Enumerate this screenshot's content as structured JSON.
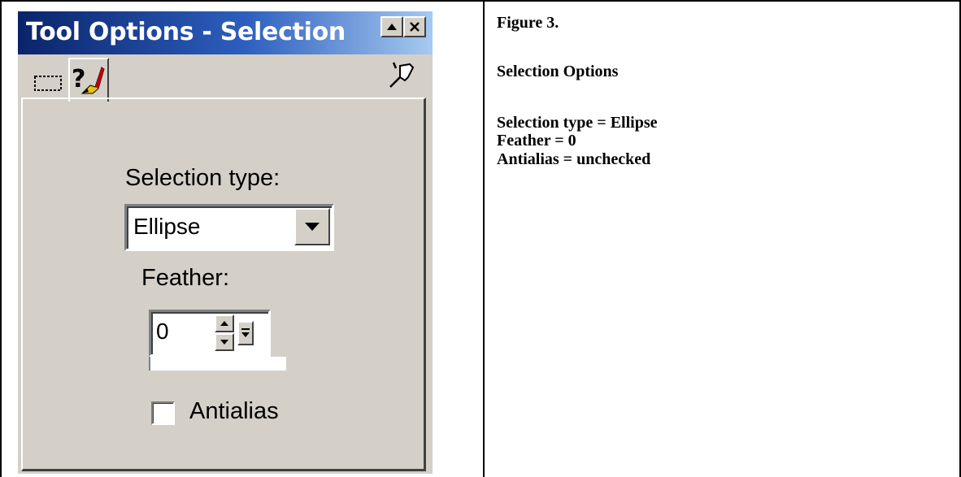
{
  "panel": {
    "title": "Tool Options - Selection",
    "title_buttons": {
      "up_arrow_icon": "up-arrow-icon",
      "close_icon": "close-icon"
    },
    "tabs": [
      {
        "icon": "selection-marquee-icon"
      },
      {
        "icon": "help-brush-icon"
      }
    ],
    "pin_icon": "pin-icon",
    "selection_type": {
      "label": "Selection type:",
      "value": "Ellipse"
    },
    "feather": {
      "label": "Feather:",
      "value": "0"
    },
    "antialias": {
      "label": "Antialias",
      "checked": false
    }
  },
  "caption": {
    "figure": "Figure 3.",
    "heading": "Selection Options",
    "lines": [
      "Selection type = Ellipse",
      "Feather = 0",
      "Antialias = unchecked"
    ]
  },
  "colors": {
    "title_gradient_start": "#0a246a",
    "title_gradient_end": "#a6caf0",
    "panel_face": "#d4d0c8"
  }
}
